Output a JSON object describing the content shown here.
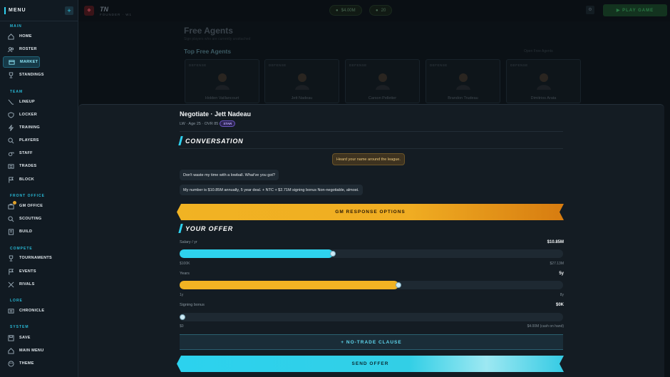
{
  "sidebar": {
    "title": "MENU",
    "toggle_icon": "+",
    "sections": {
      "main": "MAIN",
      "team": "TEAM",
      "front_office": "FRONT OFFICE",
      "compete": "COMPETE",
      "lore": "LORE",
      "system": "SYSTEM"
    },
    "items": {
      "home": "HOME",
      "roster": "ROSTER",
      "market": "MARKET",
      "standings": "STANDINGS",
      "lineup": "LINEUP",
      "locker": "LOCKER",
      "training": "TRAINING",
      "players": "PLAYERS",
      "staff": "STAFF",
      "trades": "TRADES",
      "block": "BLOCK",
      "gm_office": "GM OFFICE",
      "scouting": "SCOUTING",
      "build": "BUILD",
      "tournaments": "TOURNAMENTS",
      "events": "EVENTS",
      "rivals": "RIVALS",
      "chronicle": "CHRONICLE",
      "save": "SAVE",
      "main_menu": "MAIN MENU",
      "theme": "THEME"
    },
    "active_item": "market"
  },
  "topbar": {
    "team_abbr": "TN",
    "team_meta": "FOUNDER · W1",
    "cash": "$4.00M",
    "count": "20",
    "play_button": "▶ PLAY GAME"
  },
  "background": {
    "title": "Free Agents",
    "subtitle": "Sign players who are currently unattached",
    "section": "Top Free Agents",
    "link": "Open Free Agents",
    "cards": [
      {
        "pos": "DEFENSE",
        "name": "Holden Vaillancourt"
      },
      {
        "pos": "DEFENSE",
        "name": "Jett Nadeau"
      },
      {
        "pos": "DEFENSE",
        "name": "Carson Pelletier"
      },
      {
        "pos": "DEFENSE",
        "name": "Brandon Trudeau"
      },
      {
        "pos": "DEFENSE",
        "name": "Dimitrios Arata"
      }
    ]
  },
  "modal": {
    "title": "Negotiate · Jett Nadeau",
    "meta": "LW · Age 25 · OVR 85",
    "badge": "STAR",
    "conversation_heading": "CONVERSATION",
    "agent_message": "Heard your name around the league.",
    "player_messages": [
      "Don't waste my time with a lowball. What've you got?",
      "My number is $10.85M annually, 5 year deal. + NTC + $2.71M signing bonus Non-negotiable, almost."
    ],
    "gm_options_button": "GM RESPONSE OPTIONS",
    "offer_heading": "YOUR OFFER",
    "salary": {
      "label": "Salary / yr",
      "value": "$10.85M",
      "min": "$100K",
      "max": "$27.13M",
      "fraction": 0.4,
      "color": "#2ed3ee"
    },
    "years": {
      "label": "Years",
      "value": "5y",
      "min": "1y",
      "max": "8y",
      "fraction": 0.571,
      "color": "#f1b323"
    },
    "bonus": {
      "label": "Signing bonus",
      "value": "$0K",
      "min": "$0",
      "max": "$4.00M (cash on hand)",
      "fraction": 0.0,
      "color": "#2ed3ee"
    },
    "ntc_button": "+ NO-TRADE CLAUSE",
    "send_button": "SEND OFFER"
  }
}
